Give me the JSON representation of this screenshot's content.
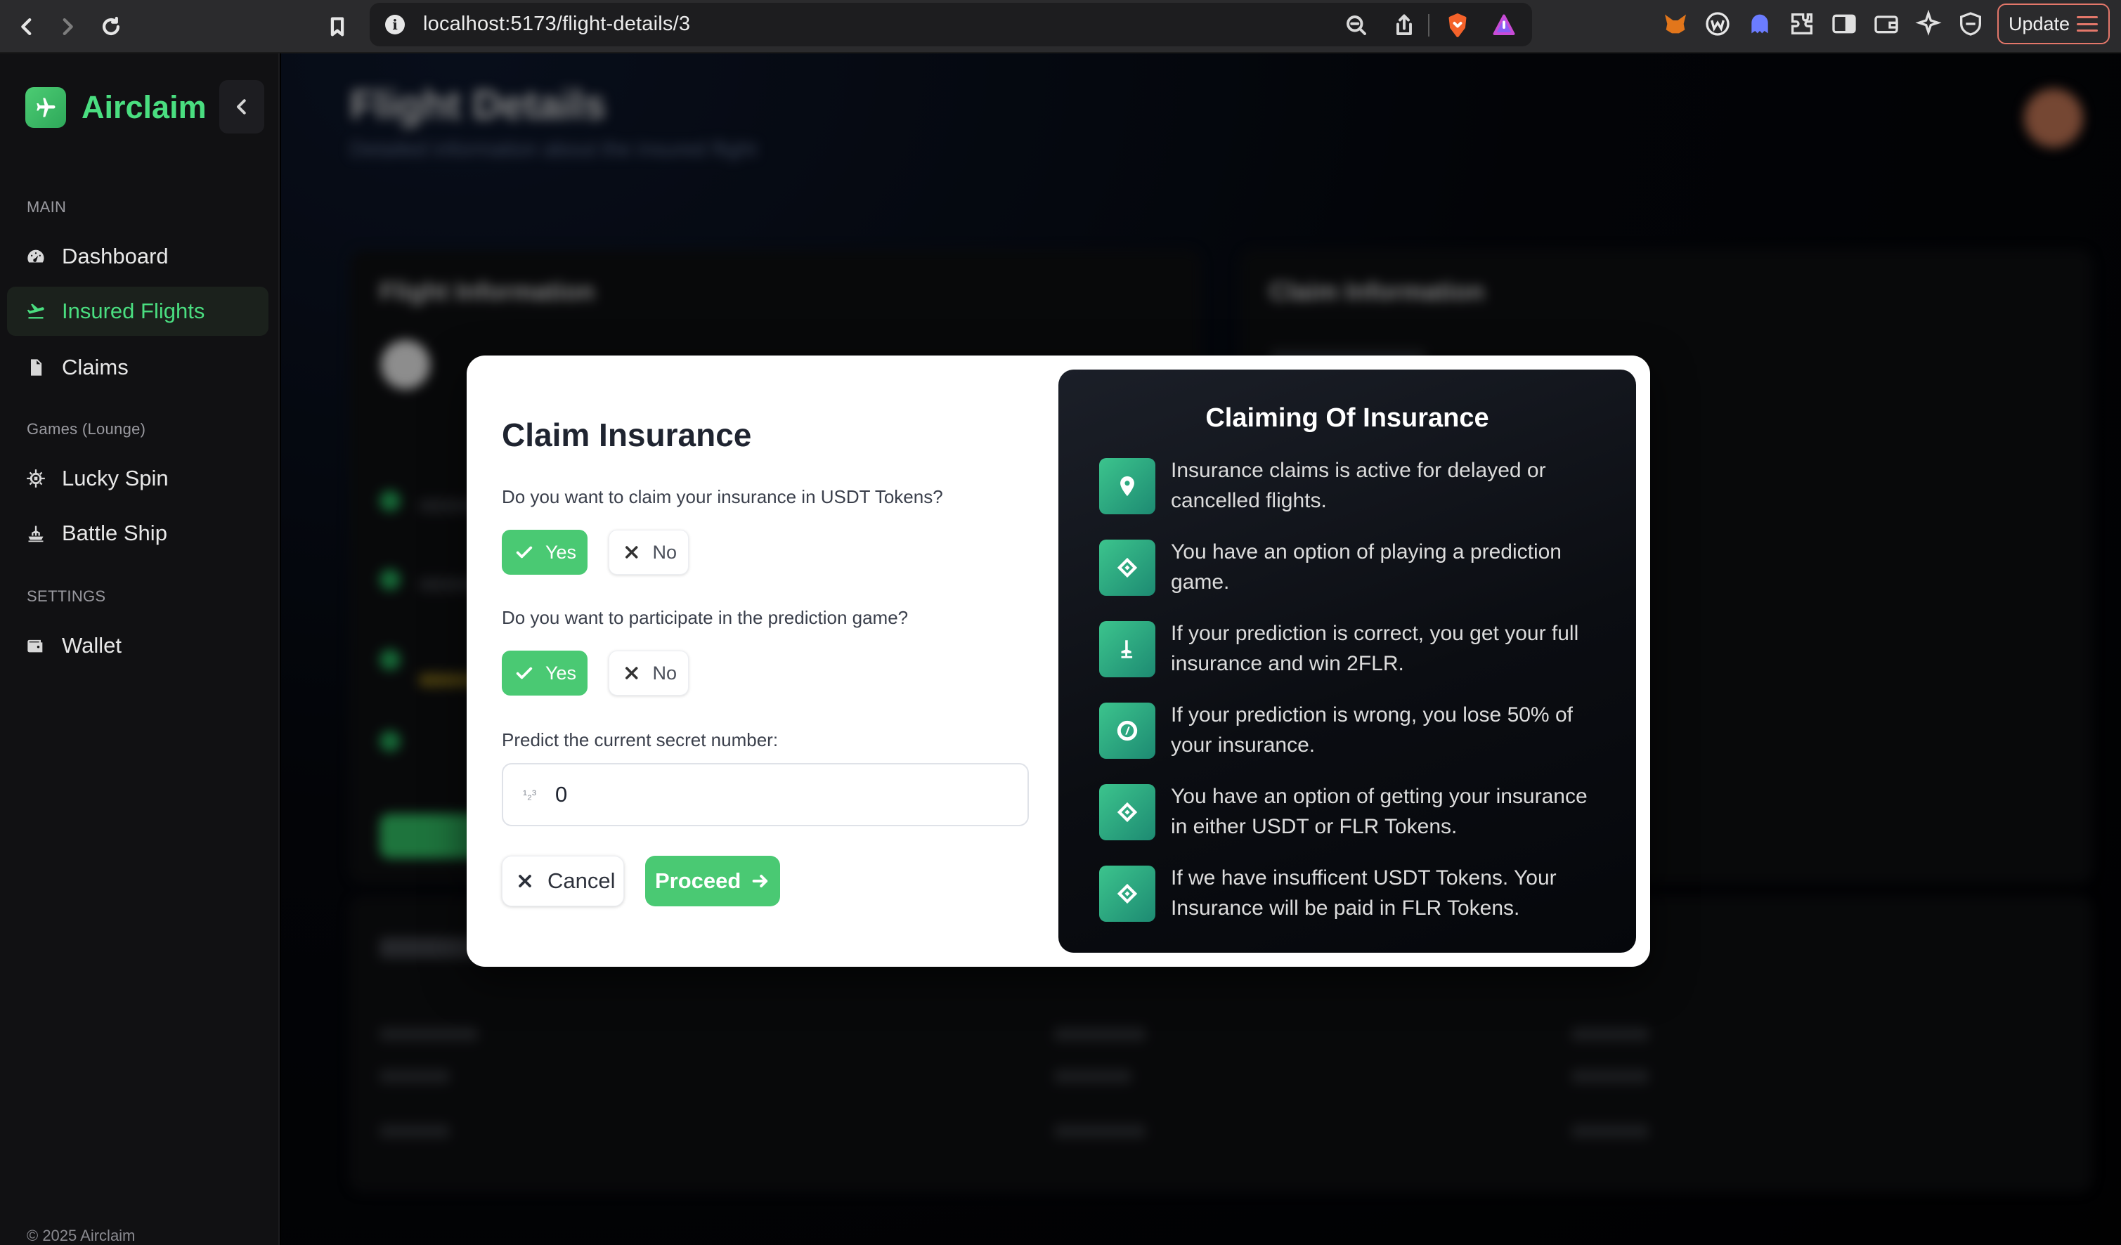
{
  "browser": {
    "url": "localhost:5173/flight-details/3",
    "update_label": "Update"
  },
  "sidebar": {
    "brand": "Airclaim",
    "section_main": "MAIN",
    "section_games": "Games (Lounge)",
    "section_settings": "SETTINGS",
    "items": [
      {
        "label": "Dashboard",
        "icon": "gauge-icon",
        "active": false
      },
      {
        "label": "Insured Flights",
        "icon": "plane-departure-icon",
        "active": true
      },
      {
        "label": "Claims",
        "icon": "file-icon",
        "active": false
      },
      {
        "label": "Lucky Spin",
        "icon": "spin-wheel-icon",
        "active": false
      },
      {
        "label": "Battle Ship",
        "icon": "ship-icon",
        "active": false
      },
      {
        "label": "Wallet",
        "icon": "wallet-icon",
        "active": false
      }
    ],
    "footer": "© 2025 Airclaim"
  },
  "background": {
    "title": "Flight Details",
    "subtitle": "Detailed information about the insured flight",
    "card_flight_title": "Flight Information",
    "card_claim_title": "Claim Information"
  },
  "modal": {
    "title": "Claim Insurance",
    "q1": "Do you want to claim your insurance in USDT Tokens?",
    "q2": "Do you want to participate in the prediction game?",
    "yes_label": "Yes",
    "no_label": "No",
    "predict_label": "Predict the current secret number:",
    "predict_value": "0",
    "cancel_label": "Cancel",
    "proceed_label": "Proceed",
    "accent_color": "#4ac973"
  },
  "info_panel": {
    "title": "Claiming Of Insurance",
    "items": [
      {
        "icon": "map-pin-icon",
        "text": "Insurance claims is active for delayed or cancelled flights."
      },
      {
        "icon": "diamond-icon",
        "text": "You have an option of playing a prediction game."
      },
      {
        "icon": "trophy-icon",
        "text": "If your prediction is correct, you get your full insurance and win 2FLR."
      },
      {
        "icon": "coin-icon",
        "text": "If your prediction is wrong, you lose 50% of your insurance."
      },
      {
        "icon": "diamond-icon",
        "text": "You have an option of getting your insurance in either USDT or FLR Tokens."
      },
      {
        "icon": "diamond-icon",
        "text": "If we have insufficent USDT Tokens. Your Insurance will be paid in FLR Tokens."
      }
    ]
  }
}
